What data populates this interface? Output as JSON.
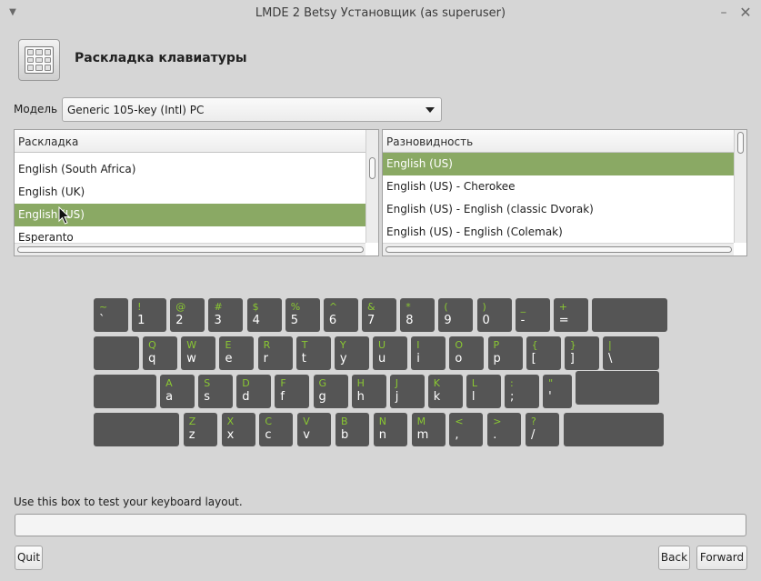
{
  "window": {
    "title": "LMDE 2 Betsy Установщик (as superuser)",
    "menu_icon": "triangle-down-icon",
    "minimize_icon": "minimize-icon",
    "close_icon": "close-icon"
  },
  "header": {
    "icon": "keyboard-icon",
    "title": "Раскладка клавиатуры"
  },
  "model": {
    "label": "Модель",
    "value": "Generic 105-key (Intl) PC"
  },
  "layout_list": {
    "header": "Раскладка",
    "items": [
      {
        "label": "English (South Africa)",
        "selected": false
      },
      {
        "label": "English (UK)",
        "selected": false
      },
      {
        "label": "English (US)",
        "selected": true
      },
      {
        "label": "Esperanto",
        "selected": false
      }
    ]
  },
  "variant_list": {
    "header": "Разновидность",
    "items": [
      {
        "label": "English (US)",
        "selected": true
      },
      {
        "label": "English (US) - Cherokee",
        "selected": false
      },
      {
        "label": "English (US) - English (classic Dvorak)",
        "selected": false
      },
      {
        "label": "English (US) - English (Colemak)",
        "selected": false
      }
    ]
  },
  "keyboard": {
    "rows": [
      [
        {
          "shift": "~",
          "base": "`"
        },
        {
          "shift": "!",
          "base": "1"
        },
        {
          "shift": "@",
          "base": "2"
        },
        {
          "shift": "#",
          "base": "3"
        },
        {
          "shift": "$",
          "base": "4"
        },
        {
          "shift": "%",
          "base": "5"
        },
        {
          "shift": "^",
          "base": "6"
        },
        {
          "shift": "&",
          "base": "7"
        },
        {
          "shift": "*",
          "base": "8"
        },
        {
          "shift": "(",
          "base": "9"
        },
        {
          "shift": ")",
          "base": "0"
        },
        {
          "shift": "_",
          "base": "-"
        },
        {
          "shift": "+",
          "base": "="
        },
        {
          "shift": "",
          "base": ""
        }
      ],
      [
        {
          "shift": "",
          "base": ""
        },
        {
          "shift": "Q",
          "base": "q"
        },
        {
          "shift": "W",
          "base": "w"
        },
        {
          "shift": "E",
          "base": "e"
        },
        {
          "shift": "R",
          "base": "r"
        },
        {
          "shift": "T",
          "base": "t"
        },
        {
          "shift": "Y",
          "base": "y"
        },
        {
          "shift": "U",
          "base": "u"
        },
        {
          "shift": "I",
          "base": "i"
        },
        {
          "shift": "O",
          "base": "o"
        },
        {
          "shift": "P",
          "base": "p"
        },
        {
          "shift": "{",
          "base": "["
        },
        {
          "shift": "}",
          "base": "]"
        },
        {
          "shift": "|",
          "base": "\\"
        }
      ],
      [
        {
          "shift": "",
          "base": ""
        },
        {
          "shift": "A",
          "base": "a"
        },
        {
          "shift": "S",
          "base": "s"
        },
        {
          "shift": "D",
          "base": "d"
        },
        {
          "shift": "F",
          "base": "f"
        },
        {
          "shift": "G",
          "base": "g"
        },
        {
          "shift": "H",
          "base": "h"
        },
        {
          "shift": "J",
          "base": "j"
        },
        {
          "shift": "K",
          "base": "k"
        },
        {
          "shift": "L",
          "base": "l"
        },
        {
          "shift": ":",
          "base": ";"
        },
        {
          "shift": "\"",
          "base": "'"
        },
        {
          "shift": "",
          "base": ""
        }
      ],
      [
        {
          "shift": "",
          "base": ""
        },
        {
          "shift": "Z",
          "base": "z"
        },
        {
          "shift": "X",
          "base": "x"
        },
        {
          "shift": "C",
          "base": "c"
        },
        {
          "shift": "V",
          "base": "v"
        },
        {
          "shift": "B",
          "base": "b"
        },
        {
          "shift": "N",
          "base": "n"
        },
        {
          "shift": "M",
          "base": "m"
        },
        {
          "shift": "<",
          "base": ","
        },
        {
          "shift": ">",
          "base": "."
        },
        {
          "shift": "?",
          "base": "/"
        },
        {
          "shift": "",
          "base": ""
        }
      ]
    ]
  },
  "test": {
    "label": "Use this box to test your keyboard layout.",
    "value": ""
  },
  "buttons": {
    "quit": "Quit",
    "back": "Back",
    "forward": "Forward"
  },
  "colors": {
    "selection": "#8aa964",
    "key_background": "#555555",
    "key_shift_label": "#8ac832"
  }
}
